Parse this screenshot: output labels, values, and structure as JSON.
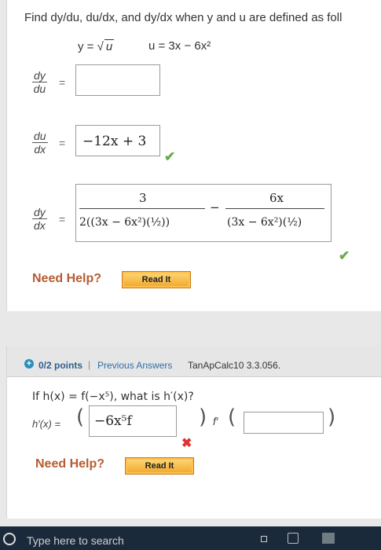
{
  "problem1": {
    "title": "Find dy/du, du/dx, and dy/dx when y and u are defined as foll",
    "y_def_lhs": "y = ",
    "y_def_rad": "u",
    "u_def": "u = 3x − 6x²",
    "rows": [
      {
        "num": "dy",
        "den": "du",
        "eq": "=",
        "answer": ""
      },
      {
        "num": "du",
        "den": "dx",
        "eq": "=",
        "answer": "−12x + 3"
      },
      {
        "num": "dy",
        "den": "dx",
        "eq": "="
      }
    ],
    "dydx": {
      "frac1_num": "3",
      "frac1_den": "2((3x − 6x²)(½))",
      "minus": "−",
      "frac2_num": "6x",
      "frac2_den": "(3x − 6x²)(½)"
    },
    "check_mark": "✔",
    "need_help": "Need Help?",
    "read_it": "Read It"
  },
  "problem2": {
    "plus": "+",
    "points": "0/2 points",
    "separator": "|",
    "previous_answers": "Previous Answers",
    "question_id": "TanApCalc10 3.3.056.",
    "question": "If h(x) = f(−x⁵), what is h′(x)?",
    "h_label": "h′(x) =",
    "open_paren": "(",
    "answer1": "−6x⁵f",
    "close_paren": ")",
    "f_prime": "f′",
    "open_paren2": "(",
    "answer2": "",
    "close_paren2": ")",
    "x_mark": "✖",
    "need_help": "Need Help?",
    "read_it": "Read It"
  },
  "taskbar": {
    "search_placeholder": "Type here to search"
  },
  "colors": {
    "check_green": "#6aa84f",
    "error_red": "#dd3333",
    "need_help_brown": "#b65c32",
    "read_button_orange": "#f0a62a",
    "link_blue": "#2f6fa8",
    "taskbar": "#1b2a3a"
  }
}
